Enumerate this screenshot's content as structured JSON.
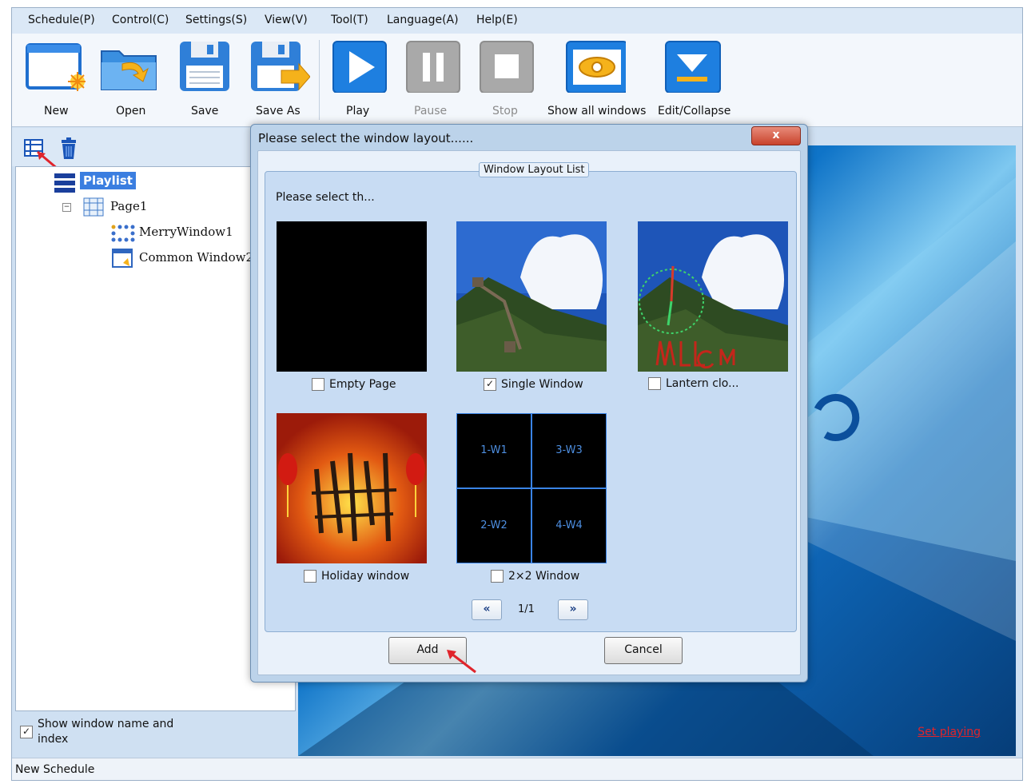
{
  "menu": [
    "Schedule(P)",
    "Control(C)",
    "Settings(S)",
    "View(V)",
    "Tool(T)",
    "Language(A)",
    "Help(E)"
  ],
  "toolbar": {
    "new": "New",
    "open": "Open",
    "save": "Save",
    "save_as": "Save As",
    "play": "Play",
    "pause": "Pause",
    "stop": "Stop",
    "show_all": "Show all windows",
    "edit_collapse": "Edit/Collapse"
  },
  "tree": {
    "playlist": "Playlist",
    "page": "Page1",
    "merry": "MerryWindow1",
    "common": "Common Window2"
  },
  "show_names": {
    "label_line1": "Show window name and",
    "label_line2": "index",
    "checked": true
  },
  "status": "New Schedule",
  "set_playing": "Set playing",
  "dialog": {
    "title": "Please select the window layout......",
    "close": "x",
    "group_title": "Window Layout List",
    "hint": "Please select th...",
    "options": [
      {
        "label": "Empty Page",
        "checked": false
      },
      {
        "label": "Single Window",
        "checked": true
      },
      {
        "label": "Lantern clo...",
        "checked": false
      },
      {
        "label": "Holiday window",
        "checked": false
      },
      {
        "label": "2×2 Window",
        "checked": false
      }
    ],
    "grid_cells": [
      "1-W1",
      "3-W3",
      "2-W2",
      "4-W4"
    ],
    "prev": "«",
    "next": "»",
    "page": "1/1",
    "add": "Add",
    "cancel": "Cancel"
  },
  "colors": {
    "accent": "#3b7ee0",
    "link": "#e0242b",
    "arrow": "#e0242b"
  }
}
